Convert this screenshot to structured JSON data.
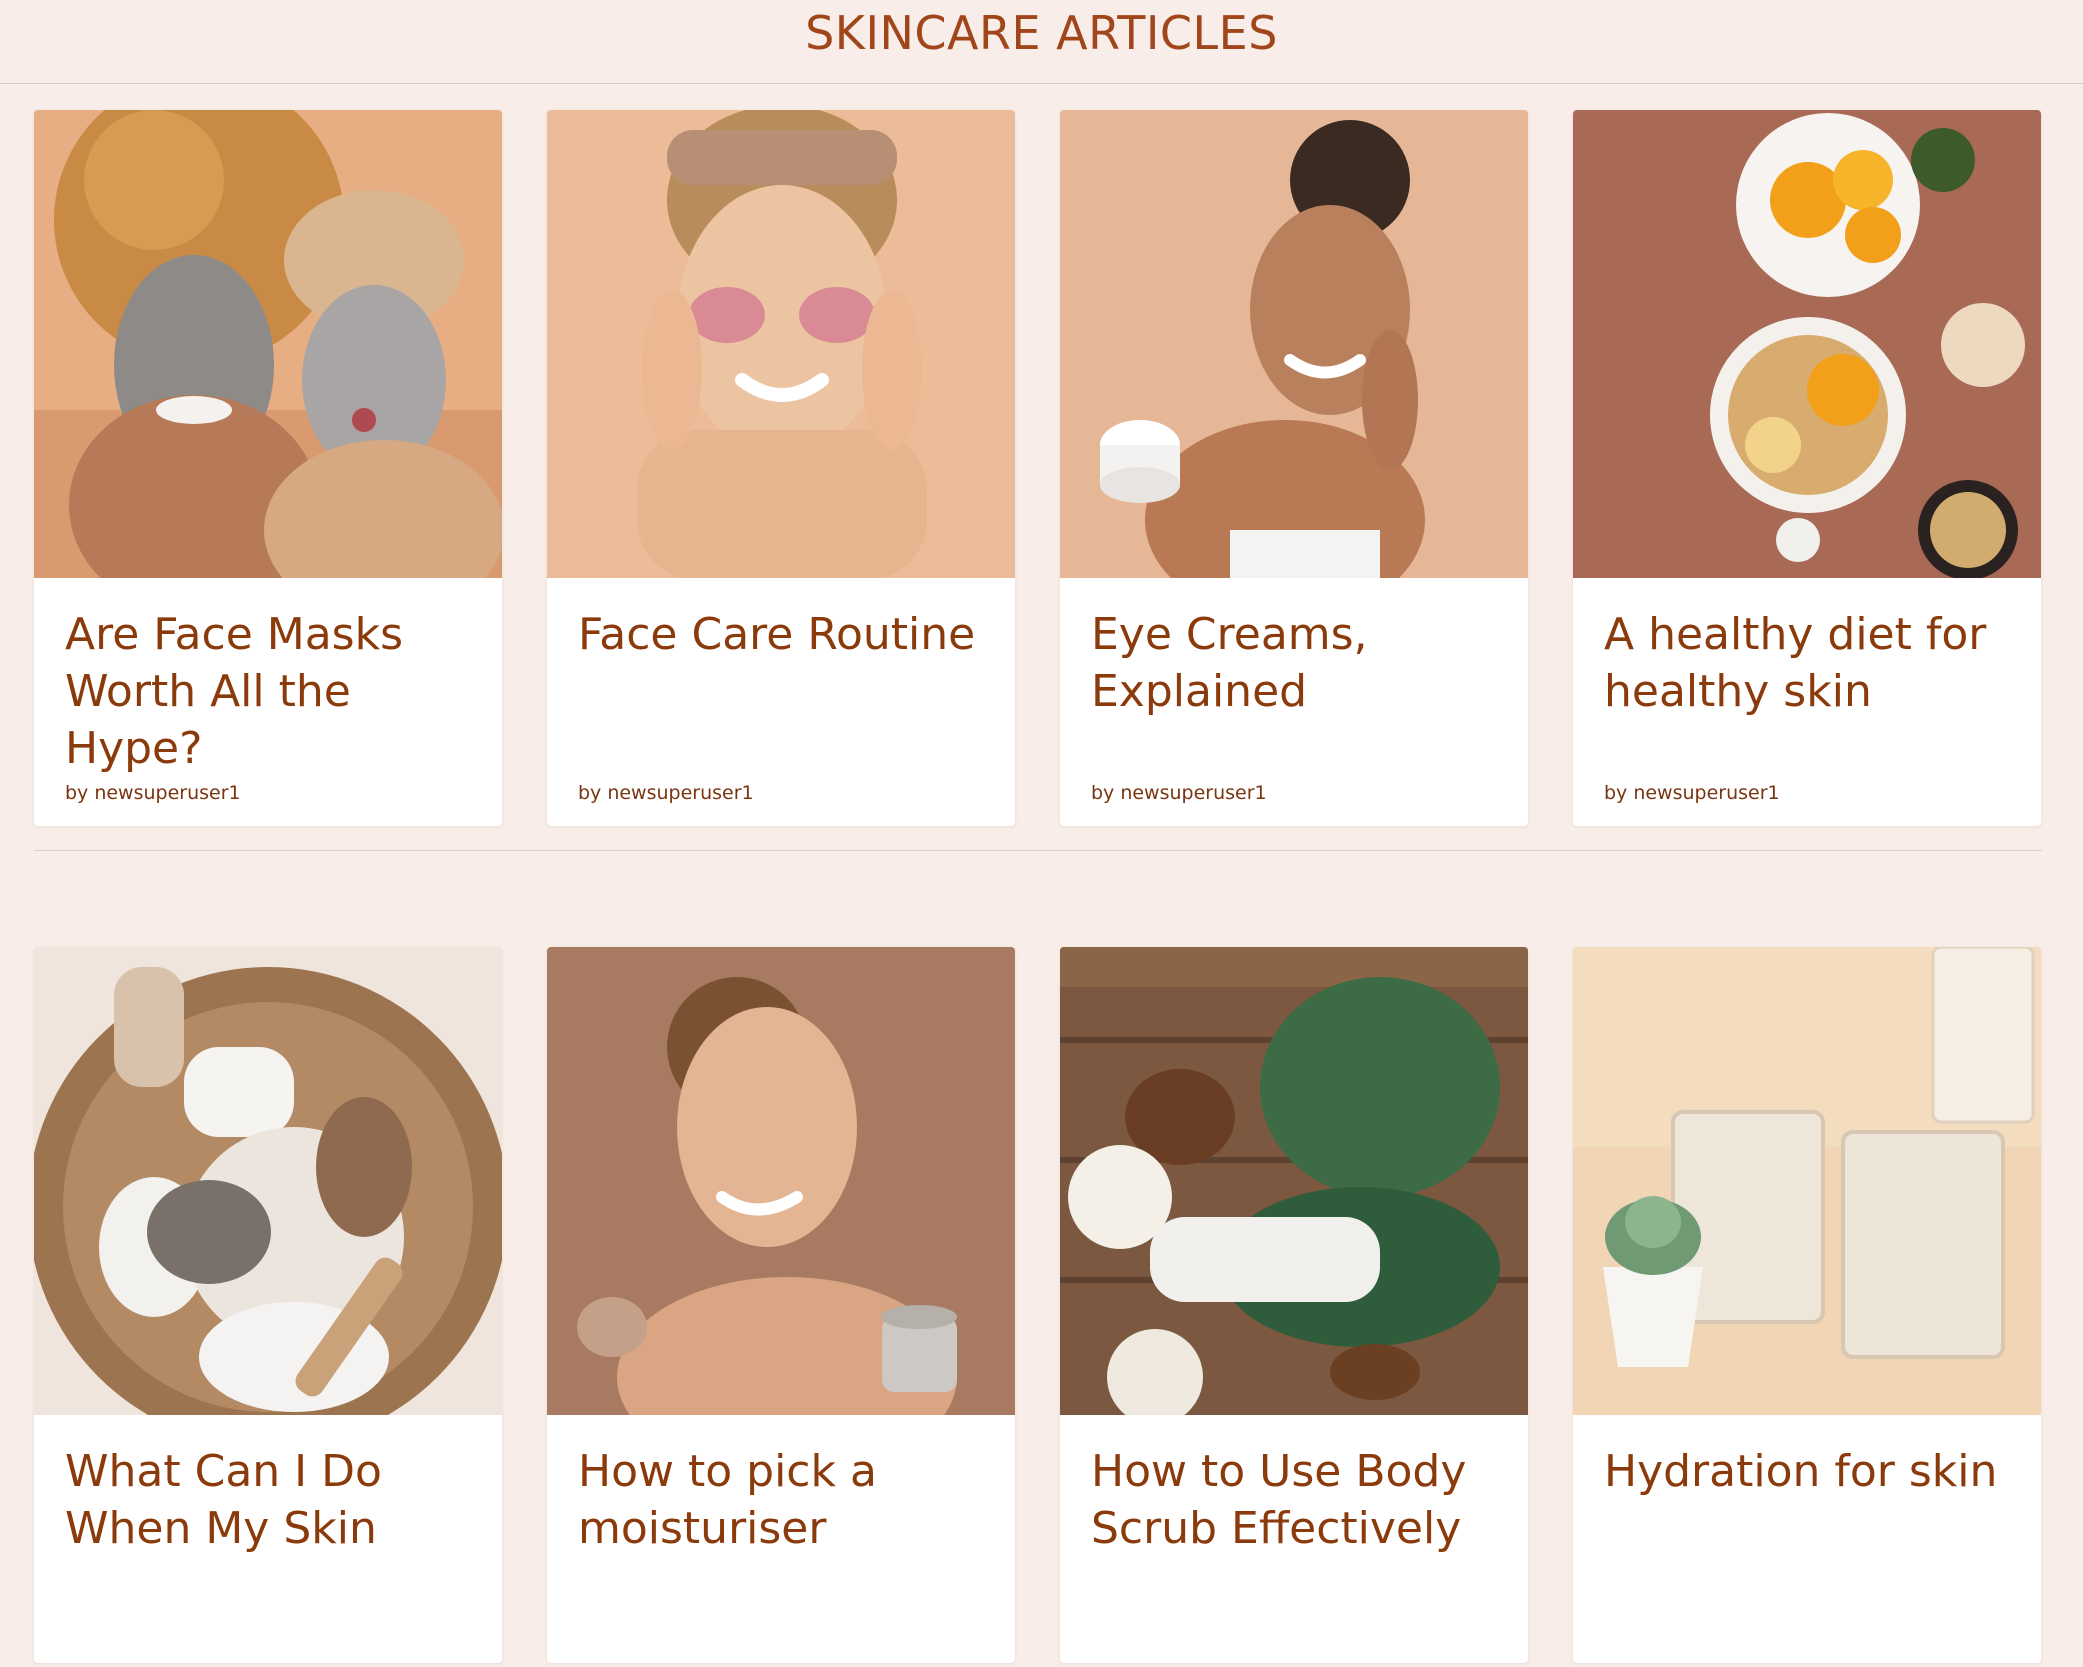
{
  "page": {
    "title": "SKINCARE ARTICLES"
  },
  "byline_prefix": "by",
  "articles": [
    {
      "title": "Are Face Masks Worth All the Hype?",
      "author": "newsuperuser1",
      "image": "two-women-clay-face-masks-photo"
    },
    {
      "title": "Face Care Routine",
      "author": "newsuperuser1",
      "image": "woman-pink-under-eye-patches-photo"
    },
    {
      "title": "Eye Creams, Explained",
      "author": "newsuperuser1",
      "image": "woman-applying-face-cream-photo"
    },
    {
      "title": "A healthy diet for healthy skin",
      "author": "newsuperuser1",
      "image": "bowls-oranges-granola-photo"
    },
    {
      "title": "What Can I Do When My Skin",
      "image": "basket-towels-bath-products-photo"
    },
    {
      "title": "How to pick a moisturiser",
      "image": "woman-holding-moisturiser-jars-photo"
    },
    {
      "title": "How to Use Body Scrub Effectively",
      "image": "body-scrub-leaves-towel-photo"
    },
    {
      "title": "Hydration for skin",
      "image": "water-glasses-succulent-photo"
    }
  ]
}
